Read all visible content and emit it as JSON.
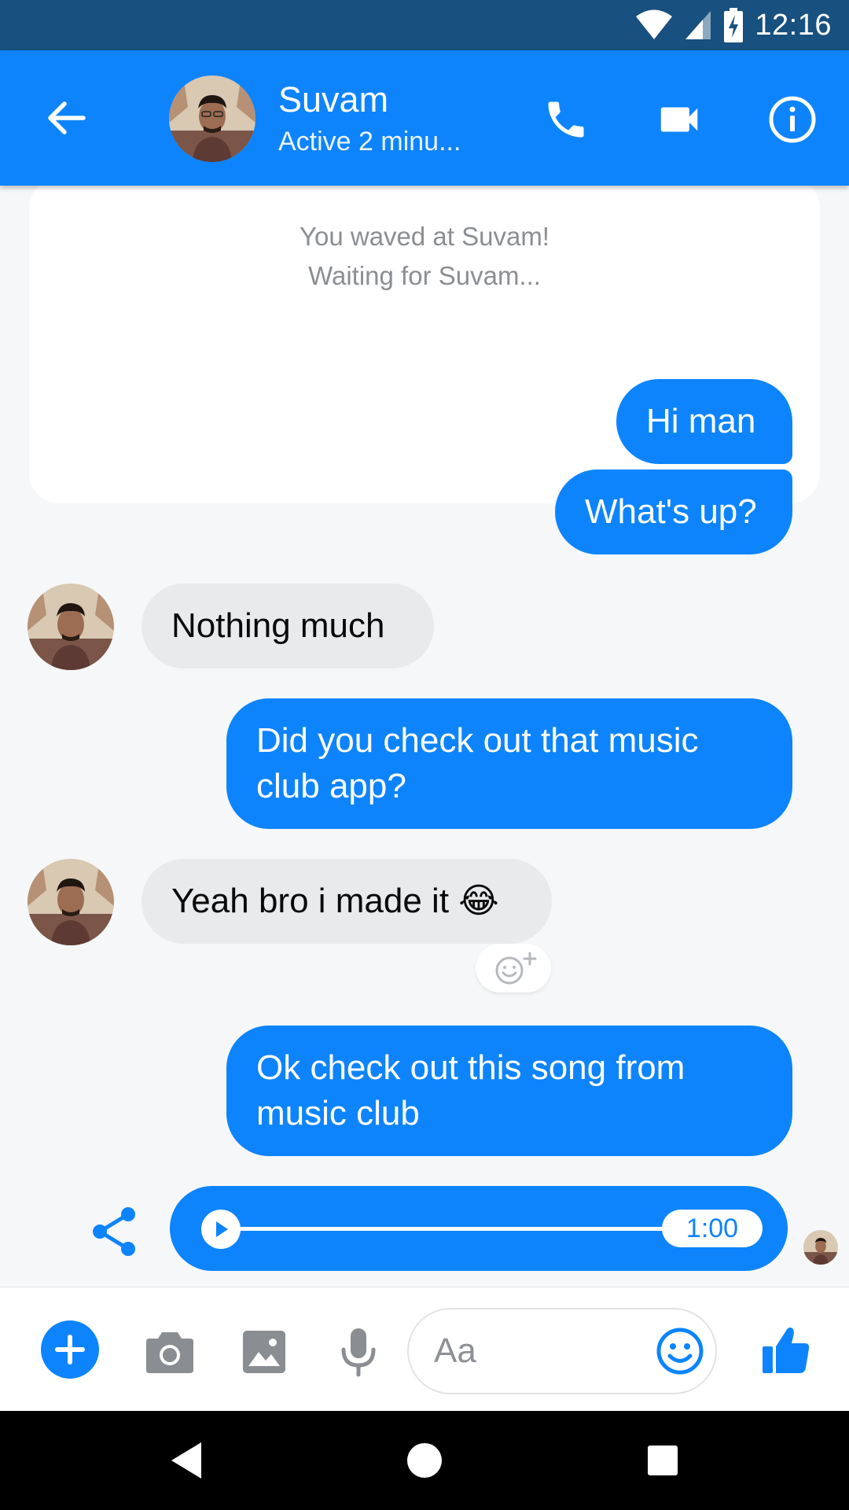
{
  "status_bar": {
    "time": "12:16",
    "icons": [
      "wifi-icon",
      "signal-icon",
      "battery-charging-icon"
    ]
  },
  "header": {
    "back_icon": "arrow-back-icon",
    "contact_name": "Suvam",
    "contact_status": "Active 2 minu...",
    "actions": [
      "phone-icon",
      "video-camera-icon",
      "info-icon"
    ]
  },
  "wave_card": {
    "line1": "You waved at Suvam!",
    "line2": "Waiting for Suvam..."
  },
  "messages": [
    {
      "direction": "outgoing",
      "text": "Hi man"
    },
    {
      "direction": "outgoing",
      "text": "What's up?"
    },
    {
      "direction": "incoming",
      "text": "Nothing much"
    },
    {
      "direction": "outgoing",
      "text": "Did you check out that music club app?"
    },
    {
      "direction": "incoming",
      "text": "Yeah bro i made it 😂"
    },
    {
      "direction": "outgoing",
      "text": "Ok check out this song from music club"
    }
  ],
  "audio_message": {
    "duration": "1:00",
    "progress": 0
  },
  "composer": {
    "placeholder": "Aa",
    "icons": [
      "plus-icon",
      "camera-icon",
      "gallery-icon",
      "microphone-icon",
      "emoji-icon",
      "thumbs-up-icon"
    ]
  },
  "colors": {
    "messenger_blue": "#0d84fc",
    "status_bar": "#18507f",
    "incoming_bubble": "#e9eaec",
    "chat_background": "#f6f7f9"
  }
}
